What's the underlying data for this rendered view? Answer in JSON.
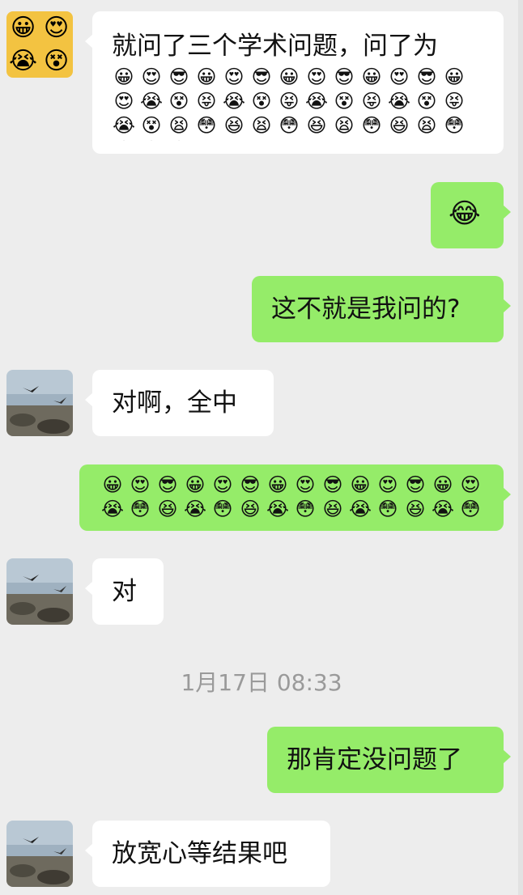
{
  "messages": [
    {
      "side": "in",
      "avatar": "emoji-avatar",
      "text": "就问了三个学术问题，问了为",
      "emoji_rows": [
        [
          "😀",
          "😍",
          "😎",
          "😀",
          "😍",
          "😎",
          "😀",
          "😍",
          "😎",
          "😀",
          "😍",
          "😎",
          "😀",
          "😍"
        ],
        [
          "😭",
          "😵",
          "😝",
          "😭",
          "😵",
          "😝",
          "😭",
          "😵",
          "😝",
          "😭",
          "😵",
          "😝",
          "😭",
          "😵"
        ],
        [
          "😫",
          "😳",
          "😆",
          "😫",
          "😳",
          "😆",
          "😫",
          "😳",
          "😆",
          "😫",
          "😳",
          "😆",
          "😫",
          "😳"
        ]
      ]
    },
    {
      "side": "out",
      "emoji": "😂"
    },
    {
      "side": "out",
      "text": "这不就是我问的?"
    },
    {
      "side": "in",
      "avatar": "bird-beach-avatar",
      "text": "对啊，全中"
    },
    {
      "side": "out",
      "emoji_rows": [
        [
          "😀",
          "😍",
          "😎",
          "😀",
          "😍",
          "😎",
          "😀",
          "😍",
          "😎",
          "😀",
          "😍",
          "😎",
          "😀",
          "😍",
          "😎"
        ],
        [
          "😭",
          "😳",
          "😆",
          "😭",
          "😳",
          "😆",
          "😭",
          "😳",
          "😆",
          "😭",
          "😳",
          "😆",
          "😭",
          "😳",
          "😆"
        ]
      ]
    },
    {
      "side": "in",
      "avatar": "bird-beach-avatar",
      "text": "对"
    },
    {
      "side": "out",
      "text": "那肯定没问题了"
    },
    {
      "side": "in",
      "avatar": "bird-beach-avatar",
      "text": "放宽心等结果吧"
    }
  ],
  "timestamp": "1月17日 08:33",
  "colors": {
    "background": "#ededed",
    "bubble_out": "#95ec69",
    "bubble_in": "#ffffff",
    "timestamp": "#9a9a9a"
  }
}
